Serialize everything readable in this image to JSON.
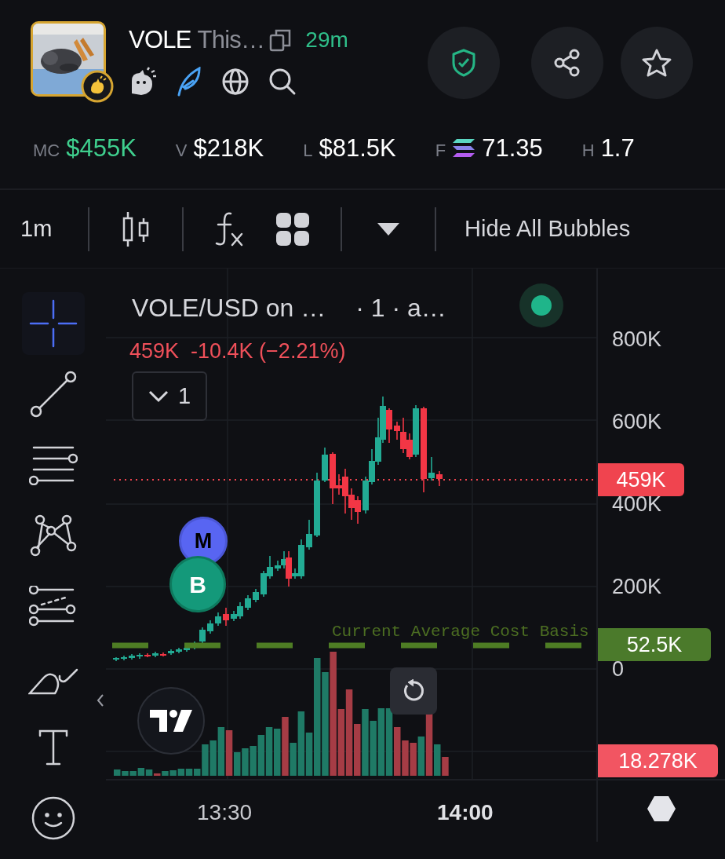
{
  "token": {
    "symbol": "VOLE",
    "name": "This…",
    "age": "29m"
  },
  "stats": [
    {
      "label": "MC",
      "value": "$455K",
      "kind": "accent"
    },
    {
      "label": "V",
      "value": "$218K",
      "kind": "plain"
    },
    {
      "label": "L",
      "value": "$81.5K",
      "kind": "plain"
    },
    {
      "label": "F",
      "value": "71.35",
      "kind": "sol"
    },
    {
      "label": "H",
      "value": "1.7",
      "kind": "plain"
    }
  ],
  "toolbar": {
    "interval": "1m",
    "bubbles_button": "Hide All Bubbles"
  },
  "tools": [
    {
      "kind": "crosshair",
      "selected": true
    },
    {
      "kind": "trend-line",
      "selected": false
    },
    {
      "kind": "parallel-lines",
      "selected": false
    },
    {
      "kind": "pattern",
      "selected": false
    },
    {
      "kind": "fib",
      "selected": false
    },
    {
      "kind": "brush",
      "selected": false
    },
    {
      "kind": "text",
      "selected": false
    },
    {
      "kind": "emoji",
      "selected": false
    }
  ],
  "chart": {
    "legend_title": "VOLE/USD on …",
    "legend_meta": "· 1 · a…",
    "legend_values": "459K  -10.4K (−2.21%)",
    "live": true,
    "collapse_count": "1",
    "y_ticks": [
      "800K",
      "600K",
      "400K",
      "200K",
      "0"
    ],
    "x_ticks": [
      {
        "label": "13:30",
        "bold": false
      },
      {
        "label": "14:00",
        "bold": true
      }
    ],
    "cost_basis": "Current Average Cost Basis",
    "markers": [
      {
        "label": "M",
        "color": "#5865f2"
      },
      {
        "label": "B",
        "color": "#14997a"
      }
    ],
    "price_tags": [
      {
        "label": "459K",
        "color": "#f0444f"
      },
      {
        "label": "52.5K",
        "color": "#4b7a2b"
      },
      {
        "label": "18.278K",
        "color": "#f25562"
      }
    ]
  }
}
